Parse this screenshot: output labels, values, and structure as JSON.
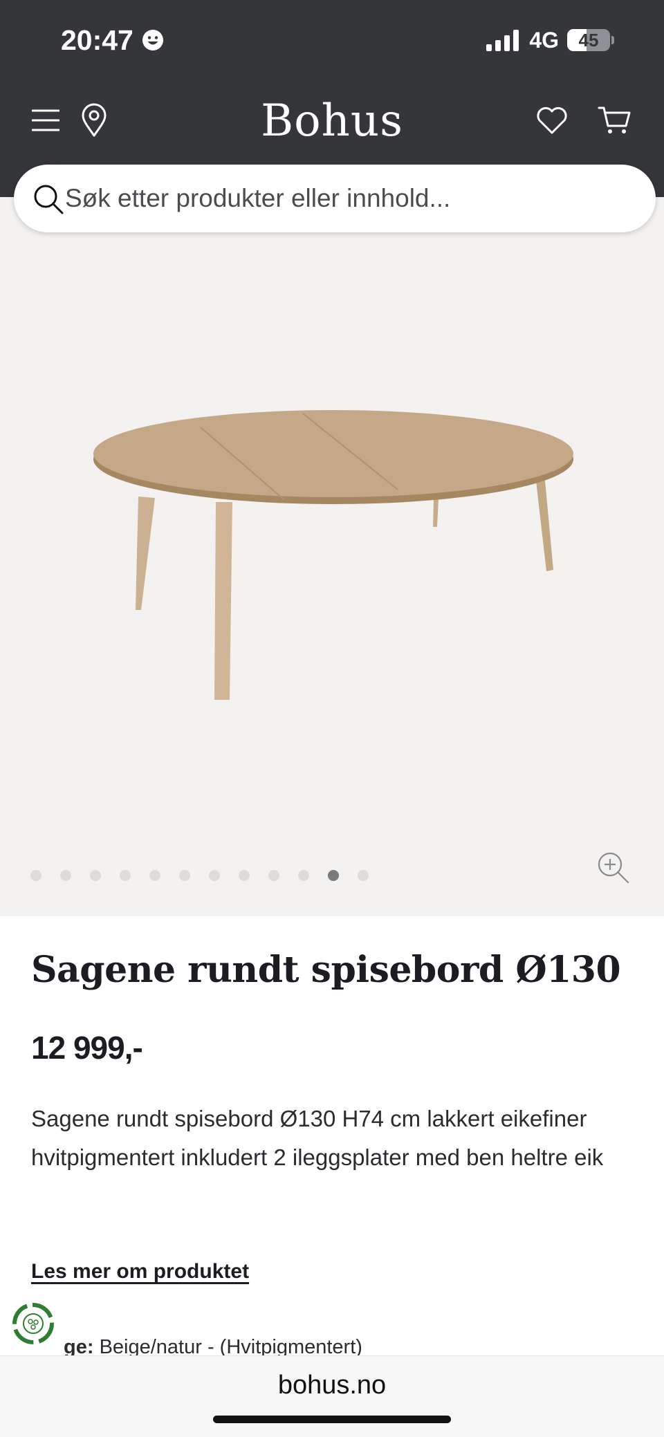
{
  "status_bar": {
    "time": "20:47",
    "network": "4G",
    "battery": "45",
    "battery_level": 0.45
  },
  "header": {
    "logo": "Bohus",
    "icons": [
      "menu-icon",
      "location-pin-icon",
      "heart-icon",
      "cart-icon"
    ]
  },
  "search": {
    "placeholder": "Søk etter produkter eller innhold..."
  },
  "gallery": {
    "image_count": 12,
    "active_index": 10,
    "zoom_icon": "zoom-in-icon"
  },
  "product": {
    "title": "Sagene rundt spisebord Ø130",
    "price": "12 999,-",
    "description": "Sagene rundt spisebord Ø130 H74 cm lakkert eikefiner hvitpigmentert inkludert 2 ileggsplater med ben heltre eik",
    "read_more": "Les mer om produktet",
    "color_label": "ge:",
    "color_value": "Beige/natur - (Hvitpigmentert)"
  },
  "browser": {
    "url": "bohus.no"
  },
  "colors": {
    "header_bg": "#35363a",
    "gallery_bg": "#f4f2f0",
    "text": "#1b1d22",
    "wood": "#c4a887",
    "eco_green": "#2f7d32"
  }
}
